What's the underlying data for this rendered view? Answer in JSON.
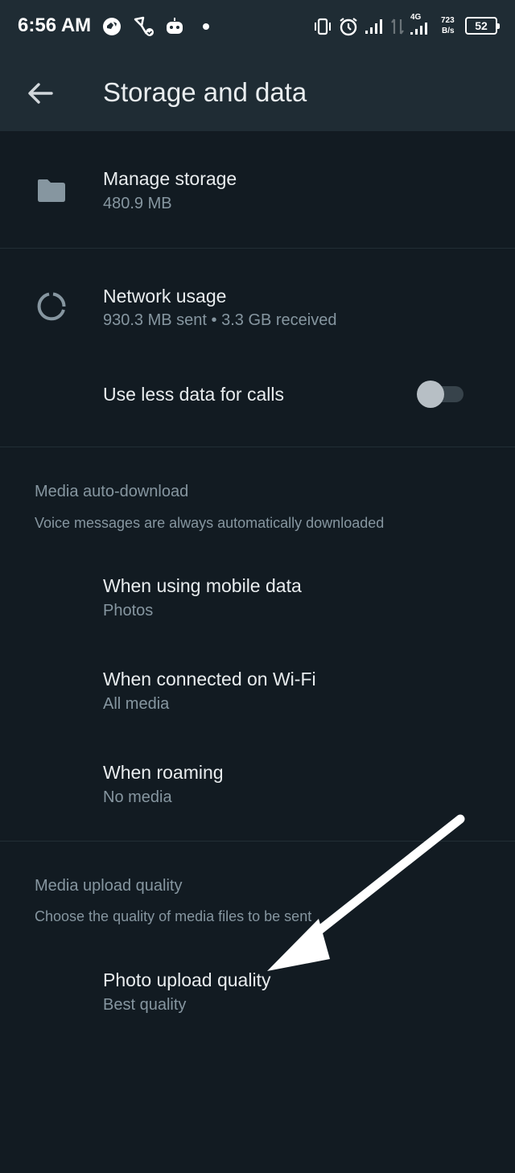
{
  "status_bar": {
    "time": "6:56 AM",
    "network_label": "4G",
    "speed_value": "723",
    "speed_unit": "B/s",
    "battery": "52",
    "icons": [
      "vpn-globe-icon",
      "route-icon",
      "android-bot-icon",
      "dot-icon",
      "vibrate-icon",
      "alarm-icon",
      "signal-icon",
      "data-arrows-icon",
      "signal-4g-icon"
    ]
  },
  "app_bar": {
    "title": "Storage and data",
    "back_icon": "arrow-left-icon"
  },
  "storage": {
    "manage_title": "Manage storage",
    "manage_sub": "480.9 MB",
    "manage_icon": "folder-icon",
    "network_title": "Network usage",
    "network_sub": "930.3 MB sent • 3.3 GB received",
    "network_icon": "data-usage-icon",
    "less_data_label": "Use less data for calls",
    "less_data_enabled": false
  },
  "auto_download": {
    "heading": "Media auto-download",
    "description": "Voice messages are always automatically downloaded",
    "items": [
      {
        "title": "When using mobile data",
        "value": "Photos"
      },
      {
        "title": "When connected on Wi-Fi",
        "value": "All media"
      },
      {
        "title": "When roaming",
        "value": "No media"
      }
    ]
  },
  "upload_quality": {
    "heading": "Media upload quality",
    "description": "Choose the quality of media files to be sent",
    "photo_title": "Photo upload quality",
    "photo_value": "Best quality"
  },
  "colors": {
    "background": "#121b22",
    "app_bar": "#1f2c34",
    "primary_text": "#e9edef",
    "secondary_text": "#8696a0",
    "annotation_arrow": "#ffffff"
  }
}
